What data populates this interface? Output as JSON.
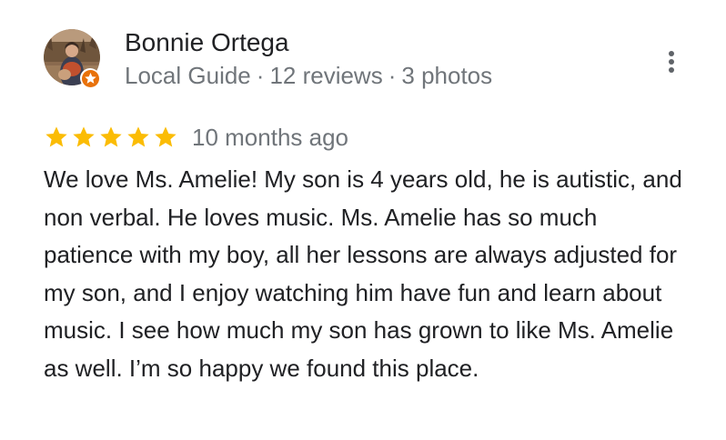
{
  "reviewer": {
    "name": "Bonnie Ortega",
    "badge_icon": "local-guide-star-icon",
    "meta": {
      "role": "Local Guide",
      "separator": "·",
      "reviews": "12 reviews",
      "photos": "3 photos"
    }
  },
  "menu": {
    "icon": "more-vertical-icon"
  },
  "rating": {
    "stars": 5,
    "max_stars": 5,
    "star_color": "#fbbc04",
    "date": "10 months ago"
  },
  "review": {
    "text": "We love Ms. Amelie! My son is 4 years old, he is autistic, and non verbal. He loves music. Ms. Amelie has so much patience with my boy, all her lessons are always adjusted for my son, and I enjoy watching him have fun and learn about music. I see how much my son has grown to like Ms. Amelie as well. I’m so happy we found this place."
  },
  "colors": {
    "primary_text": "#202124",
    "secondary_text": "#70757a",
    "badge_orange": "#e8710a"
  }
}
